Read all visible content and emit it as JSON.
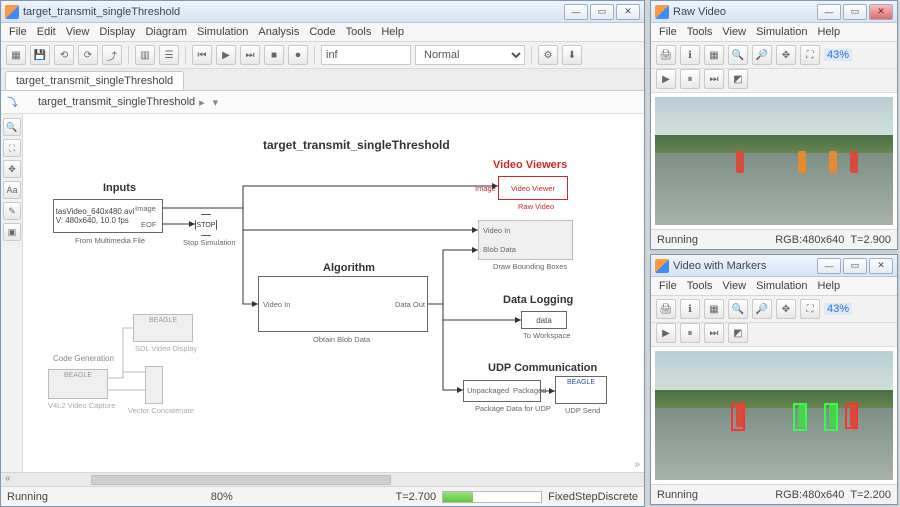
{
  "simulink": {
    "title": "target_transmit_singleThreshold",
    "menu": [
      "File",
      "Edit",
      "View",
      "Display",
      "Diagram",
      "Simulation",
      "Analysis",
      "Code",
      "Tools",
      "Help"
    ],
    "toolbar": {
      "stop_time": "inf",
      "mode": "Normal"
    },
    "tab": "target_transmit_singleThreshold",
    "breadcrumb": "target_transmit_singleThreshold",
    "diagram": {
      "title": "target_transmit_singleThreshold",
      "sections": {
        "inputs": "Inputs",
        "algorithm": "Algorithm",
        "video_viewers": "Video Viewers",
        "data_logging": "Data Logging",
        "udp": "UDP Communication",
        "codegen": "Code Generation"
      },
      "blocks": {
        "media_file": "tasVideo_640x480.avi\nV: 480x640, 10.0 fps",
        "media_file_caption": "From Multimedia File",
        "media_ports": {
          "image": "Image",
          "eof": "EOF"
        },
        "stop": "STOP",
        "stop_caption": "Stop Simulation",
        "alg_in": "Video In",
        "alg_out": "Data Out",
        "alg_caption": "Obtain Blob Data",
        "video_viewer": "Video Viewer",
        "video_viewer_port": "Image",
        "raw_video_caption": "Raw Video",
        "draw_bbox": {
          "vin": "Video In",
          "bdata": "Blob Data"
        },
        "draw_bbox_caption": "Draw Bounding Boxes",
        "data": "data",
        "to_workspace_caption": "To Workspace",
        "package": {
          "in": "Unpackaged",
          "out": "Packaged"
        },
        "package_caption": "Package Data for UDP",
        "udp_send": "BEAGLE",
        "udp_send_caption": "UDP Send",
        "sdl_display": "BEAGLE",
        "sdl_display_caption": "SDL Video Display",
        "v4l2": "BEAGLE",
        "v4l2_caption": "V4L2 Video Capture",
        "vector_concat_caption": "Vector Concatenate"
      }
    },
    "status": {
      "state": "Running",
      "progress": "80%",
      "time": "T=2.700",
      "solver": "FixedStepDiscrete"
    }
  },
  "raw_video": {
    "title": "Raw Video",
    "menu": [
      "File",
      "Tools",
      "View",
      "Simulation",
      "Help"
    ],
    "zoom": "43%",
    "status": {
      "state": "Running",
      "format": "RGB:480x640",
      "time": "T=2.900"
    }
  },
  "markers_video": {
    "title": "Video with Markers",
    "menu": [
      "File",
      "Tools",
      "View",
      "Simulation",
      "Help"
    ],
    "zoom": "43%",
    "status": {
      "state": "Running",
      "format": "RGB:480x640",
      "time": "T=2.200"
    }
  }
}
